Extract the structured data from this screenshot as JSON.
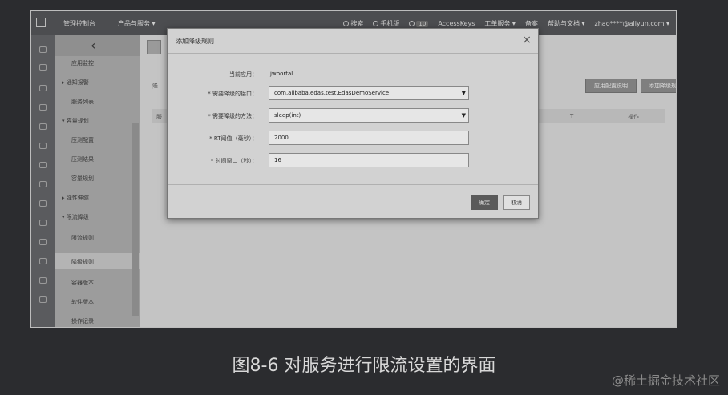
{
  "topbar": {
    "console": "管理控制台",
    "products": "产品与服务 ▾",
    "search": "搜索",
    "mobile": "手机版",
    "badge": "10",
    "accesskeys": "AccessKeys",
    "tickets": "工单服务 ▾",
    "billing": "备案",
    "help": "帮助与文档 ▾",
    "user": "zhao****@aliyun.com ▾"
  },
  "sidebar": {
    "items": [
      {
        "label": "应用监控"
      },
      {
        "label": "▸ 通知报警"
      },
      {
        "label": "服务列表"
      },
      {
        "label": "▾ 容量规划"
      },
      {
        "label": "压测配置"
      },
      {
        "label": "压测结果"
      },
      {
        "label": "容量规划"
      },
      {
        "label": "▸ 弹性伸缩"
      },
      {
        "label": "▾ 限流降级"
      },
      {
        "label": "限流规则"
      },
      {
        "label": "降级规则"
      },
      {
        "label": "容器版本"
      },
      {
        "label": "软件版本"
      },
      {
        "label": "操作记录"
      }
    ]
  },
  "content": {
    "tab": "降",
    "btn1": "应用配置说明",
    "btn2": "添加降级规则",
    "col_first": "服",
    "col_mid": "T",
    "col_ops": "操作"
  },
  "modal": {
    "title": "添加降级规则",
    "close": "×",
    "current_app_label": "当前应用：",
    "current_app_value": "jwportal",
    "interface_label": "* 需要降级的接口：",
    "interface_value": "com.alibaba.edas.test.EdasDemoService",
    "method_label": "* 需要降级的方法：",
    "method_value": "sleep(int)",
    "rt_label": "* RT阈值（毫秒）：",
    "rt_value": "2000",
    "window_label": "* 时间窗口（秒）：",
    "window_value": "16",
    "ok": "确定",
    "cancel": "取消"
  },
  "caption": "图8-6 对服务进行限流设置的界面",
  "watermark": "@稀土掘金技术社区"
}
